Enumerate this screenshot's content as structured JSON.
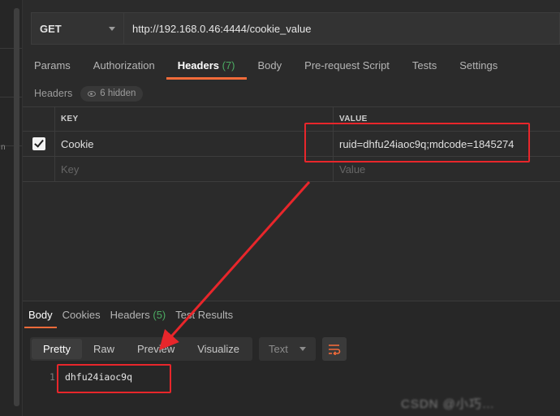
{
  "request": {
    "method": "GET",
    "url": "http://192.168.0.46:4444/cookie_value"
  },
  "request_tabs": [
    {
      "label": "Params",
      "count": ""
    },
    {
      "label": "Authorization",
      "count": ""
    },
    {
      "label": "Headers",
      "count": "(7)"
    },
    {
      "label": "Body",
      "count": ""
    },
    {
      "label": "Pre-request Script",
      "count": ""
    },
    {
      "label": "Tests",
      "count": ""
    },
    {
      "label": "Settings",
      "count": ""
    }
  ],
  "headers_section": {
    "title": "Headers",
    "hidden_label": "6 hidden"
  },
  "headers_table": {
    "col_key": "KEY",
    "col_value": "VALUE",
    "rows": [
      {
        "key": "Cookie",
        "value": "ruid=dhfu24iaoc9q;mdcode=1845274",
        "checked": true
      }
    ],
    "placeholder_key": "Key",
    "placeholder_value": "Value"
  },
  "response_tabs": [
    {
      "label": "Body",
      "count": ""
    },
    {
      "label": "Cookies",
      "count": ""
    },
    {
      "label": "Headers",
      "count": "(5)"
    },
    {
      "label": "Test Results",
      "count": ""
    }
  ],
  "view_modes": [
    "Pretty",
    "Raw",
    "Preview",
    "Visualize"
  ],
  "format_select": "Text",
  "response_body": {
    "line_number": "1",
    "text": "dhfu24iaoc9q"
  },
  "gutter_glyph": "n",
  "watermark": "CSDN @小巧…",
  "colors": {
    "accent": "#f26b3a",
    "count_green": "#4cab62",
    "annotation_red": "#e8262b",
    "background": "#2b2b2b"
  }
}
